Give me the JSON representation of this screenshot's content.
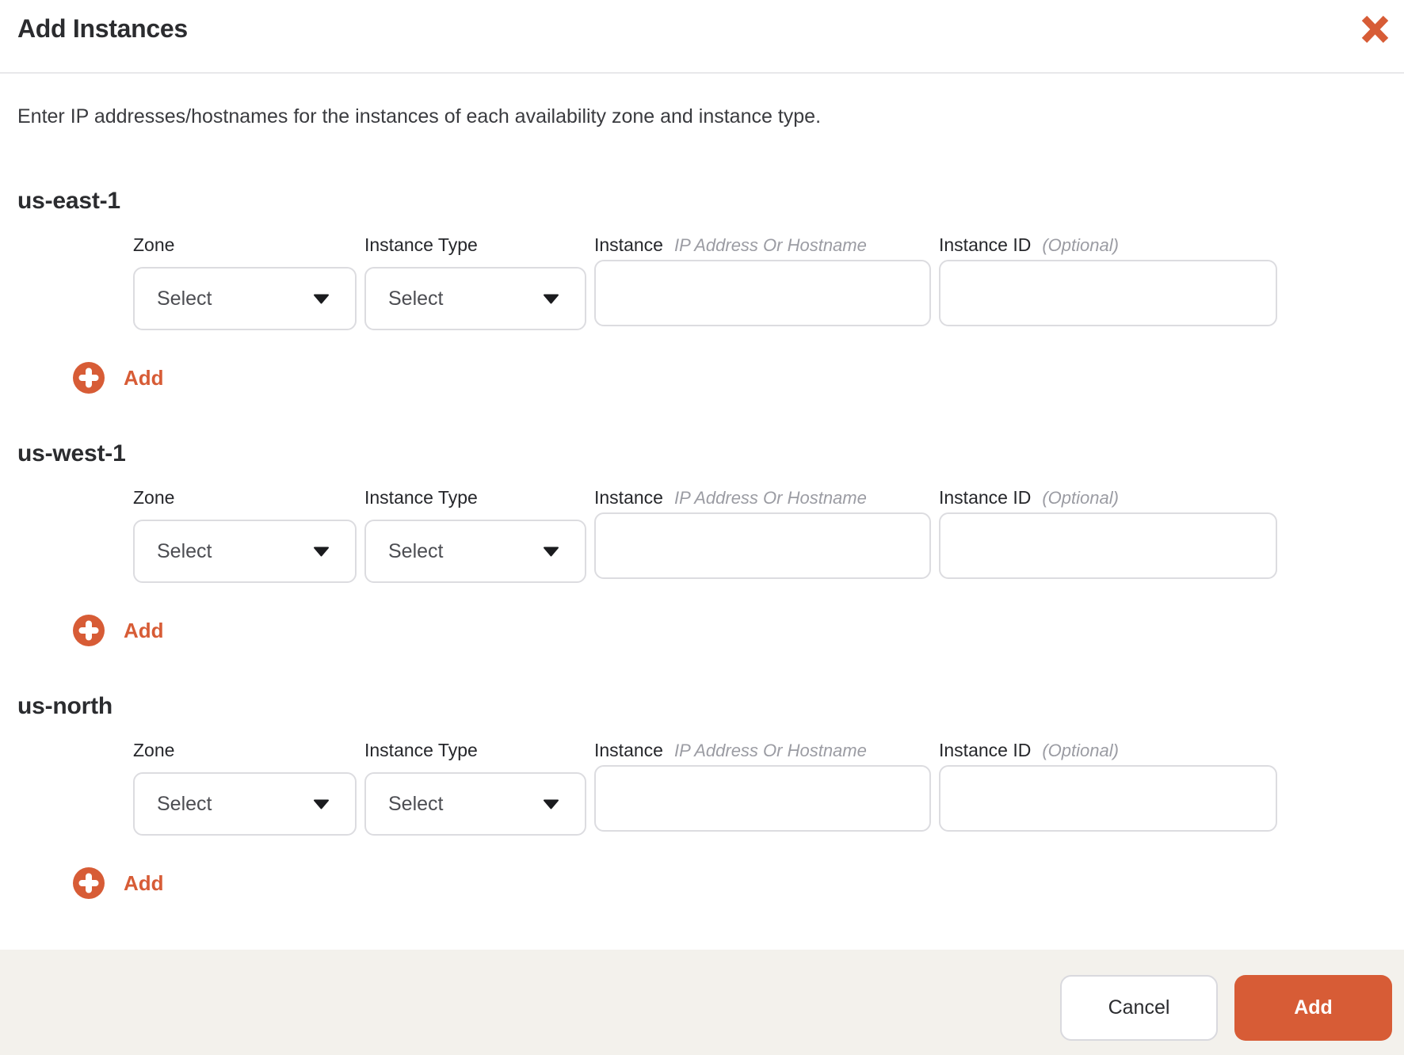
{
  "modal": {
    "title": "Add Instances",
    "description": "Enter IP addresses/hostnames for the instances of each availability zone and instance type."
  },
  "labels": {
    "zone": "Zone",
    "instance_type": "Instance Type",
    "instance": "Instance",
    "instance_hint": "IP Address Or Hostname",
    "instance_id": "Instance ID",
    "instance_id_hint": "(Optional)"
  },
  "controls": {
    "select_placeholder": "Select",
    "add_row_label": "Add",
    "instance_value": "",
    "instance_id_value": ""
  },
  "sections": [
    {
      "title": "us-east-1"
    },
    {
      "title": "us-west-1"
    },
    {
      "title": "us-north"
    }
  ],
  "footer": {
    "cancel_label": "Cancel",
    "add_label": "Add"
  },
  "colors": {
    "accent": "#d75c36",
    "footer_bg": "#f3f1ec"
  },
  "icons": {
    "close": "x-icon",
    "add": "plus-circle-icon",
    "select_caret": "chevron-down-icon"
  }
}
